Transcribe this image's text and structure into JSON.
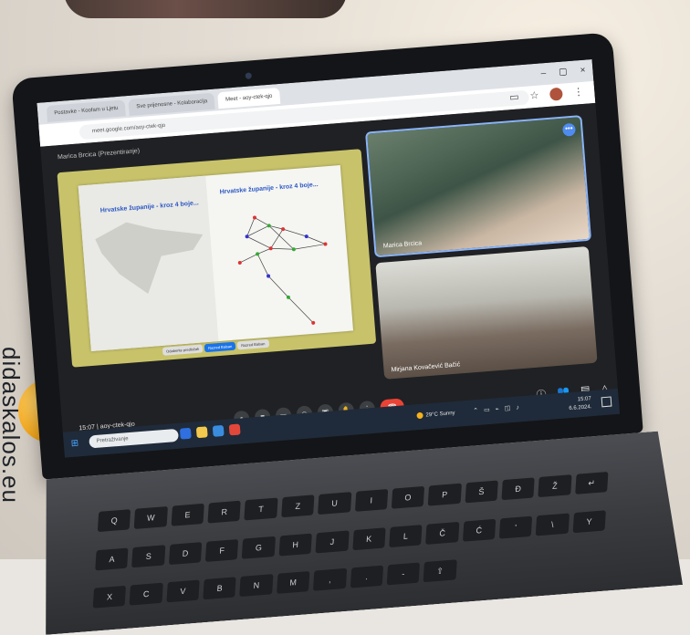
{
  "side_text": "didaskalos.eu",
  "browser": {
    "tabs": [
      "Postavke - Koofam u Ljetu",
      "Sve prijenosne - Kolaboracija",
      "Meet - aoy-ctek-qjo"
    ],
    "url": "meet.google.com/aoy-ctek-qjo",
    "window_controls": [
      "–",
      "▢",
      "×"
    ]
  },
  "meet": {
    "presenter_label": "Marica Brcica (Prezentiranje)",
    "slide": {
      "title_left": "Hrvatske županije - kroz 4 boje...",
      "title_right": "Hrvatske županije - kroz 4 boje...",
      "controls": [
        "Odaberite predložak",
        "Razred Balsan",
        "Razred Balsan"
      ]
    },
    "participants": [
      {
        "name": "Marica Brcica"
      },
      {
        "name": "Mirjana Kovačević Bačić"
      }
    ],
    "more_icon": "•••",
    "meeting_time": "15:07 | aoy-ctek-qjo",
    "controls": [
      "mic-icon",
      "camera-icon",
      "captions-icon",
      "emoji-icon",
      "present-icon",
      "hand-icon",
      "more-icon",
      "end-call-icon"
    ],
    "right_controls": [
      "info-icon",
      "people-icon",
      "chat-icon",
      "activities-icon"
    ]
  },
  "taskbar": {
    "search_placeholder": "Pretraživanje",
    "weather": "29°C  Sunny",
    "time": "15:07",
    "date": "6.6.2024."
  },
  "keyboard": [
    "Q",
    "W",
    "E",
    "R",
    "T",
    "Z",
    "U",
    "I",
    "O",
    "P",
    "Š",
    "Đ",
    "Ž",
    "↵",
    "A",
    "S",
    "D",
    "F",
    "G",
    "H",
    "J",
    "K",
    "L",
    "Č",
    "Ć",
    "'",
    "\\",
    "Y",
    "X",
    "C",
    "V",
    "B",
    "N",
    "M",
    ",",
    ".",
    "-",
    "⇧"
  ]
}
